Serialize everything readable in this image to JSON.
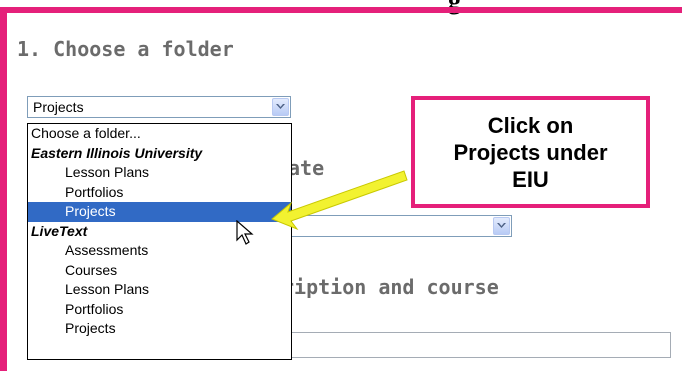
{
  "clip_title": "g",
  "step1": {
    "heading": "1. Choose a folder"
  },
  "folder_select": {
    "value": "Projects"
  },
  "step2": {
    "heading_fragment": "ate"
  },
  "step3": {
    "heading_fragment": "ription and course"
  },
  "dropdown": {
    "options": [
      {
        "label": "Choose a folder...",
        "kind": "placeholder"
      },
      {
        "label": "Eastern Illinois University",
        "kind": "group"
      },
      {
        "label": "Lesson Plans",
        "kind": "child"
      },
      {
        "label": "Portfolios",
        "kind": "child"
      },
      {
        "label": "Projects",
        "kind": "child",
        "selected": true
      },
      {
        "label": "LiveText",
        "kind": "group"
      },
      {
        "label": "Assessments",
        "kind": "child"
      },
      {
        "label": "Courses",
        "kind": "child"
      },
      {
        "label": "Lesson Plans",
        "kind": "child"
      },
      {
        "label": "Portfolios",
        "kind": "child"
      },
      {
        "label": "Projects",
        "kind": "child"
      }
    ]
  },
  "callout": {
    "text": "Click on\nProjects under\nEIU"
  },
  "colors": {
    "frame": "#e5207a",
    "arrow": "#f2f230",
    "selected_bg": "#316ac5",
    "heading": "#6b6b6b"
  },
  "icons": {
    "dropdown_arrow": "chevron-down-icon",
    "cursor": "mouse-pointer-icon",
    "arrow": "arrow-left-icon"
  }
}
